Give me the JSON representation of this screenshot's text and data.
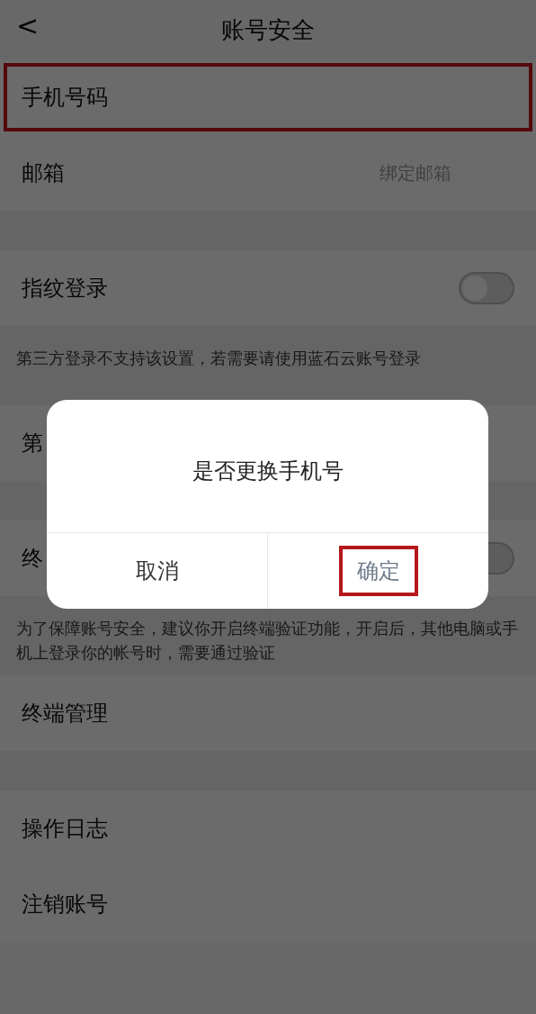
{
  "header": {
    "back": "<",
    "title": "账号安全"
  },
  "rows": [
    {
      "kind": "link",
      "label": "手机号码",
      "value": "",
      "highlighted": true,
      "gap_after": false
    },
    {
      "kind": "link",
      "label": "邮箱",
      "value": "绑定邮箱",
      "highlighted": false,
      "gap_after": true
    },
    {
      "kind": "toggle",
      "label": "指纹登录",
      "on": false,
      "note": "第三方登录不支持该设置，若需要请使用蓝石云账号登录",
      "highlighted": false,
      "gap_after": false
    },
    {
      "kind": "link",
      "label": "第",
      "value": "",
      "highlighted": false,
      "gap_after": true
    },
    {
      "kind": "toggle",
      "label": "终",
      "on": false,
      "note": "为了保障账号安全，建议你开启终端验证功能，开启后，其他电脑或手机上登录你的帐号时，需要通过验证",
      "highlighted": false,
      "gap_after": false
    },
    {
      "kind": "link",
      "label": "终端管理",
      "value": "",
      "highlighted": false,
      "gap_after": true
    },
    {
      "kind": "link",
      "label": "操作日志",
      "value": "",
      "highlighted": false,
      "gap_after": false
    },
    {
      "kind": "link",
      "label": "注销账号",
      "value": "",
      "highlighted": false,
      "gap_after": false
    }
  ],
  "dialog": {
    "message": "是否更换手机号",
    "buttons": [
      {
        "label": "取消",
        "highlighted": false
      },
      {
        "label": "确定",
        "highlighted": true
      }
    ]
  }
}
